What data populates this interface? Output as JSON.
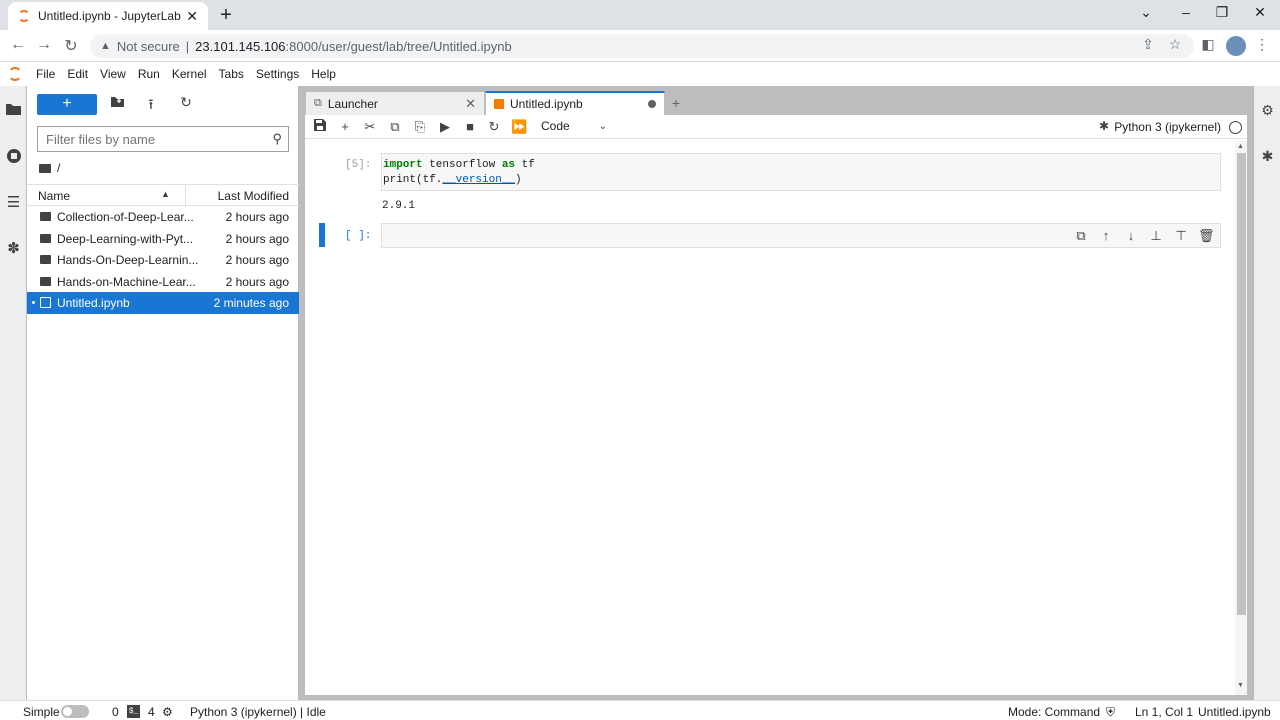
{
  "browser": {
    "tab_title": "Untitled.ipynb - JupyterLab",
    "security_label": "Not secure",
    "url_host": "23.101.145.106",
    "url_rest": ":8000/user/guest/lab/tree/Untitled.ipynb"
  },
  "menubar": {
    "items": [
      "File",
      "Edit",
      "View",
      "Run",
      "Kernel",
      "Tabs",
      "Settings",
      "Help"
    ]
  },
  "filebrowser": {
    "filter_placeholder": "Filter files by name",
    "path": "/",
    "col_name": "Name",
    "col_modified": "Last Modified",
    "files": [
      {
        "name": "Collection-of-Deep-Lear...",
        "modified": "2 hours ago",
        "type": "folder"
      },
      {
        "name": "Deep-Learning-with-Pyt...",
        "modified": "2 hours ago",
        "type": "folder"
      },
      {
        "name": "Hands-On-Deep-Learnin...",
        "modified": "2 hours ago",
        "type": "folder"
      },
      {
        "name": "Hands-on-Machine-Lear...",
        "modified": "2 hours ago",
        "type": "folder"
      },
      {
        "name": "Untitled.ipynb",
        "modified": "2 minutes ago",
        "type": "notebook",
        "selected": true
      }
    ]
  },
  "tabs": {
    "launcher": "Launcher",
    "notebook": "Untitled.ipynb"
  },
  "toolbar": {
    "cell_type": "Code",
    "kernel": "Python 3 (ipykernel)"
  },
  "cells": {
    "cell1_prompt": "[5]:",
    "cell1_line1_kw": "import",
    "cell1_line1_mid": " tensorflow ",
    "cell1_line1_kw2": "as",
    "cell1_line1_end": " tf",
    "cell1_line2_start": "print(tf.",
    "cell1_line2_dunder": "__version__",
    "cell1_line2_end": ")",
    "cell1_output": "2.9.1",
    "cell2_prompt": "[ ]:"
  },
  "statusbar": {
    "simple": "Simple",
    "count1": "0",
    "count2": "4",
    "kernel_status": "Python 3 (ipykernel) | Idle",
    "mode": "Mode: Command",
    "position": "Ln 1, Col 1",
    "filename": "Untitled.ipynb"
  }
}
